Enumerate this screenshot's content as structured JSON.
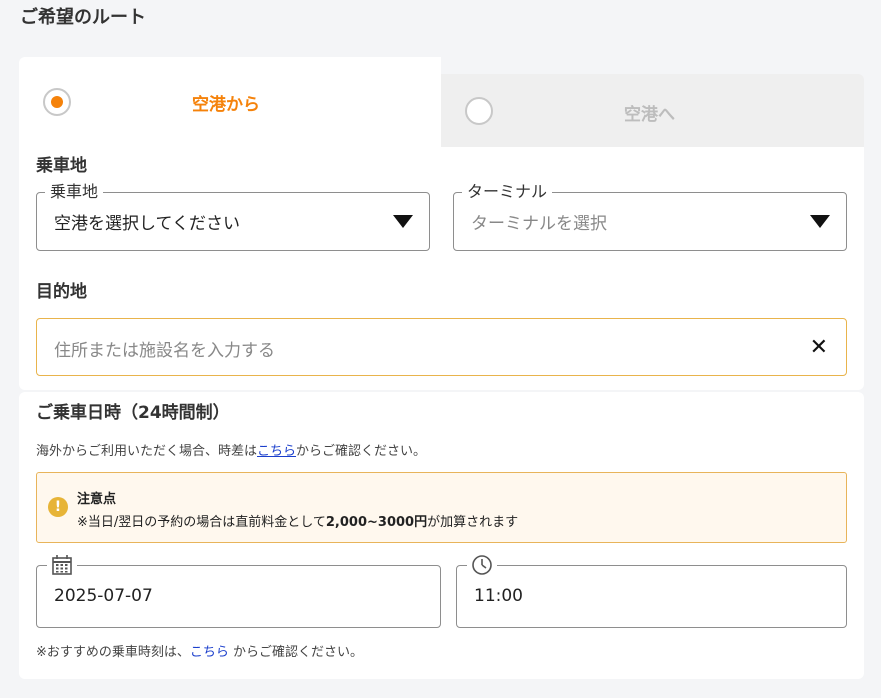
{
  "page": {
    "title": "ご希望のルート"
  },
  "tabs": [
    {
      "label": "空港から",
      "selected": true,
      "color": "#f5820a"
    },
    {
      "label": "空港へ",
      "selected": false,
      "color": "#bdbdbd"
    }
  ],
  "pickup": {
    "section_label": "乗車地",
    "boarding": {
      "legend": "乗車地",
      "value": "空港を選択してください"
    },
    "terminal": {
      "legend": "ターミナル",
      "placeholder": "ターミナルを選択"
    }
  },
  "destination": {
    "label": "目的地",
    "placeholder": "住所または施設名を入力する"
  },
  "datetime": {
    "title": "ご乗車日時（24時間制）",
    "timezone_prefix": "海外からご利用いただく場合、時差は",
    "timezone_link": "こちら",
    "timezone_suffix": "からご確認ください。",
    "warning": {
      "title": "注意点",
      "text_prefix": "※当日/翌日の予約の場合は直前料金として",
      "text_bold": "2,000~3000円",
      "text_suffix": "が加算されます"
    },
    "date_value": "2025-07-07",
    "time_value": "11:00",
    "recommend_prefix": "※おすすめの乗車時刻は、",
    "recommend_link": "こちら",
    "recommend_suffix": " からご確認ください。"
  }
}
